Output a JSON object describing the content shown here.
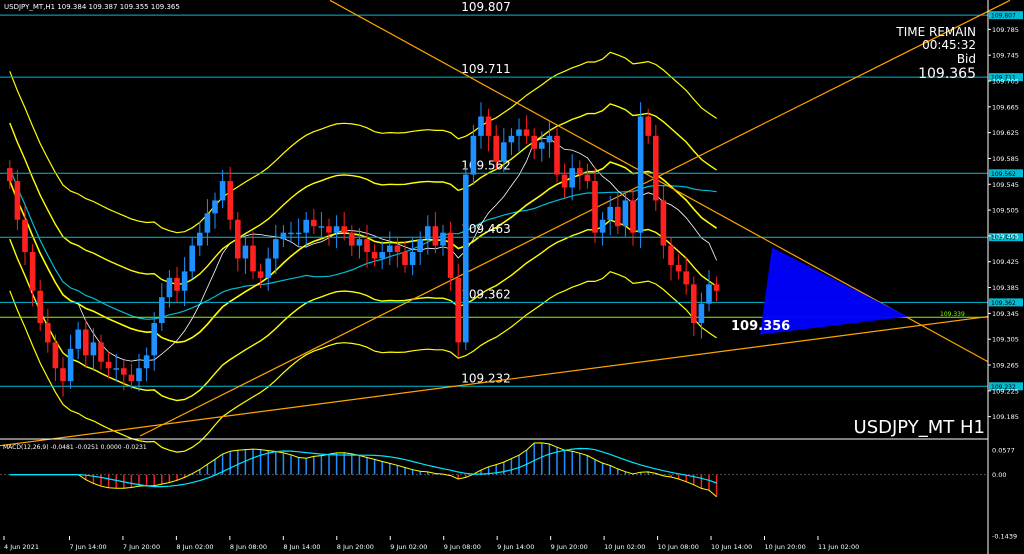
{
  "window": {
    "header_text": "USDJPY_MT,H1  109.384 109.387 109.355 109.365"
  },
  "info_panel": {
    "time_remain_label": "TIME REMAIN",
    "time_remain_value": "00:45:32",
    "bid_label": "Bid",
    "bid_value": "109.365"
  },
  "watermark": "USDJPY_MT H1",
  "current_price_big": "109.356",
  "colors": {
    "background": "#000000",
    "bull": "#1e90ff",
    "bear": "#ff2020",
    "level_line": "#00bcd4",
    "bands": "#ffff00",
    "trendline": "#ffa500",
    "triangle": "#0000ff",
    "macd_hist_pos": "#1e90ff",
    "macd_hist_neg": "#ff2020",
    "macd_signal": "#00e5ff",
    "macd_line": "#ffff00",
    "bid_line": "#7fff00"
  },
  "chart_data": {
    "type": "candlestick",
    "symbol": "USDJPY_MT",
    "timeframe": "H1",
    "ylim": [
      109.155,
      109.815
    ],
    "y_ticks": [
      "109.785",
      "109.745",
      "109.705",
      "109.665",
      "109.625",
      "109.585",
      "109.545",
      "109.505",
      "109.465",
      "109.425",
      "109.385",
      "109.345",
      "109.305",
      "109.265",
      "109.225",
      "109.185"
    ],
    "x_ticks": [
      "4 Jun 2021",
      "7 Jun 14:00",
      "7 Jun 20:00",
      "8 Jun 02:00",
      "8 Jun 08:00",
      "8 Jun 14:00",
      "8 Jun 20:00",
      "9 Jun 02:00",
      "9 Jun 08:00",
      "9 Jun 14:00",
      "9 Jun 20:00",
      "10 Jun 02:00",
      "10 Jun 08:00",
      "10 Jun 14:00",
      "10 Jun 20:00",
      "11 Jun 02:00"
    ],
    "levels": [
      {
        "price": 109.807,
        "label": "109.807",
        "tag": "109.807"
      },
      {
        "price": 109.711,
        "label": "109.711",
        "tag": "109.711"
      },
      {
        "price": 109.562,
        "label": "109.562",
        "tag": "109.562"
      },
      {
        "price": 109.463,
        "label": "109.463",
        "tag": "109.463"
      },
      {
        "price": 109.362,
        "label": "109.362",
        "tag": "109.362"
      },
      {
        "price": 109.232,
        "label": "109.232",
        "tag": "109.232"
      }
    ],
    "bid_line": {
      "price": 109.339,
      "label": "109.339"
    },
    "close_series": [
      109.55,
      109.49,
      109.44,
      109.38,
      109.33,
      109.3,
      109.26,
      109.24,
      109.29,
      109.32,
      109.28,
      109.3,
      109.27,
      109.26,
      109.26,
      109.25,
      109.24,
      109.26,
      109.28,
      109.33,
      109.37,
      109.4,
      109.38,
      109.41,
      109.45,
      109.47,
      109.5,
      109.52,
      109.55,
      109.49,
      109.43,
      109.45,
      109.41,
      109.4,
      109.43,
      109.46,
      109.47,
      109.47,
      109.47,
      109.49,
      109.48,
      109.48,
      109.47,
      109.48,
      109.47,
      109.45,
      109.46,
      109.44,
      109.43,
      109.44,
      109.45,
      109.44,
      109.42,
      109.44,
      109.46,
      109.48,
      109.45,
      109.47,
      109.4,
      109.3,
      109.56,
      109.62,
      109.65,
      109.62,
      109.58,
      109.61,
      109.62,
      109.63,
      109.62,
      109.6,
      109.61,
      109.62,
      109.56,
      109.54,
      109.57,
      109.56,
      109.55,
      109.47,
      109.49,
      109.51,
      109.48,
      109.52,
      109.47,
      109.65,
      109.62,
      109.52,
      109.45,
      109.42,
      109.41,
      109.39,
      109.33,
      109.36,
      109.39,
      109.38
    ]
  },
  "macd": {
    "label": "MACD(12,26,9) -0.0481 -0.0251 0.0000 -0.0231",
    "y_ticks": [
      "0.0577",
      "0.00",
      "-0.1439"
    ],
    "ylim": [
      -0.1439,
      0.0577
    ]
  }
}
